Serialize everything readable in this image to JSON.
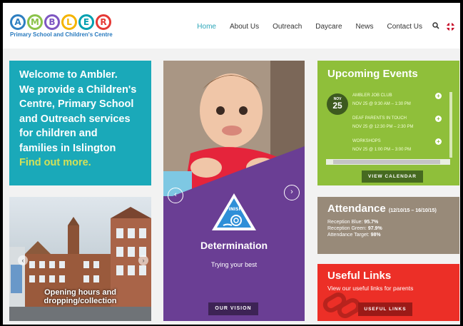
{
  "logo": {
    "letters": [
      {
        "char": "A",
        "color": "#2e7fc1"
      },
      {
        "char": "M",
        "color": "#8bc34a"
      },
      {
        "char": "B",
        "color": "#7e57c2"
      },
      {
        "char": "L",
        "color": "#f4b400"
      },
      {
        "char": "E",
        "color": "#00a0b0"
      },
      {
        "char": "R",
        "color": "#e53935"
      }
    ],
    "subtitle": "Primary School and Children's Centre"
  },
  "nav": {
    "items": [
      {
        "label": "Home",
        "active": true
      },
      {
        "label": "About Us"
      },
      {
        "label": "Outreach"
      },
      {
        "label": "Daycare"
      },
      {
        "label": "News"
      },
      {
        "label": "Contact Us"
      }
    ],
    "search_icon": "search-icon",
    "language_icon": "uk-flag-icon"
  },
  "welcome": {
    "lines": [
      "Welcome to Ambler.",
      "We provide a Children's",
      "Centre, Primary School",
      "and Outreach services",
      "for children and",
      "families in Islington"
    ],
    "link": "Find out more."
  },
  "photo": {
    "caption_line1": "Opening hours and",
    "caption_line2": "dropping/collection"
  },
  "center": {
    "badge_text": "FINISH",
    "title": "Determination",
    "subtitle": "Trying your best",
    "button": "OUR VISION"
  },
  "events": {
    "title": "Upcoming Events",
    "date": {
      "month": "NOV",
      "day": "25"
    },
    "items": [
      {
        "title": "AMBLER JOB CLUB",
        "when": "NOV 25 @ 9:30 AM – 1:30 PM"
      },
      {
        "title": "DEAF PARENTS IN TOUCH",
        "when": "NOV 25 @ 12:30 PM – 2:30 PM"
      },
      {
        "title": "WORKSHOPS",
        "when": "NOV 25 @ 1:00 PM – 3:00 PM"
      }
    ],
    "button": "VIEW CALENDAR"
  },
  "attendance": {
    "title": "Attendance",
    "period": "(12/10/15 – 16/10/15)",
    "lines": [
      {
        "label": "Reception Blue:",
        "value": "95.7%"
      },
      {
        "label": "Reception Green:",
        "value": "97.9%"
      },
      {
        "label": "Attendance Target:",
        "value": "98%"
      }
    ]
  },
  "useful": {
    "title": "Useful Links",
    "subtitle": "View our useful links for parents",
    "button": "USEFUL LINKS"
  },
  "colors": {
    "teal": "#1aa9b9",
    "purple": "#6a3e94",
    "green": "#8fbf3a",
    "taupe": "#988a79",
    "red": "#ec2f27"
  }
}
